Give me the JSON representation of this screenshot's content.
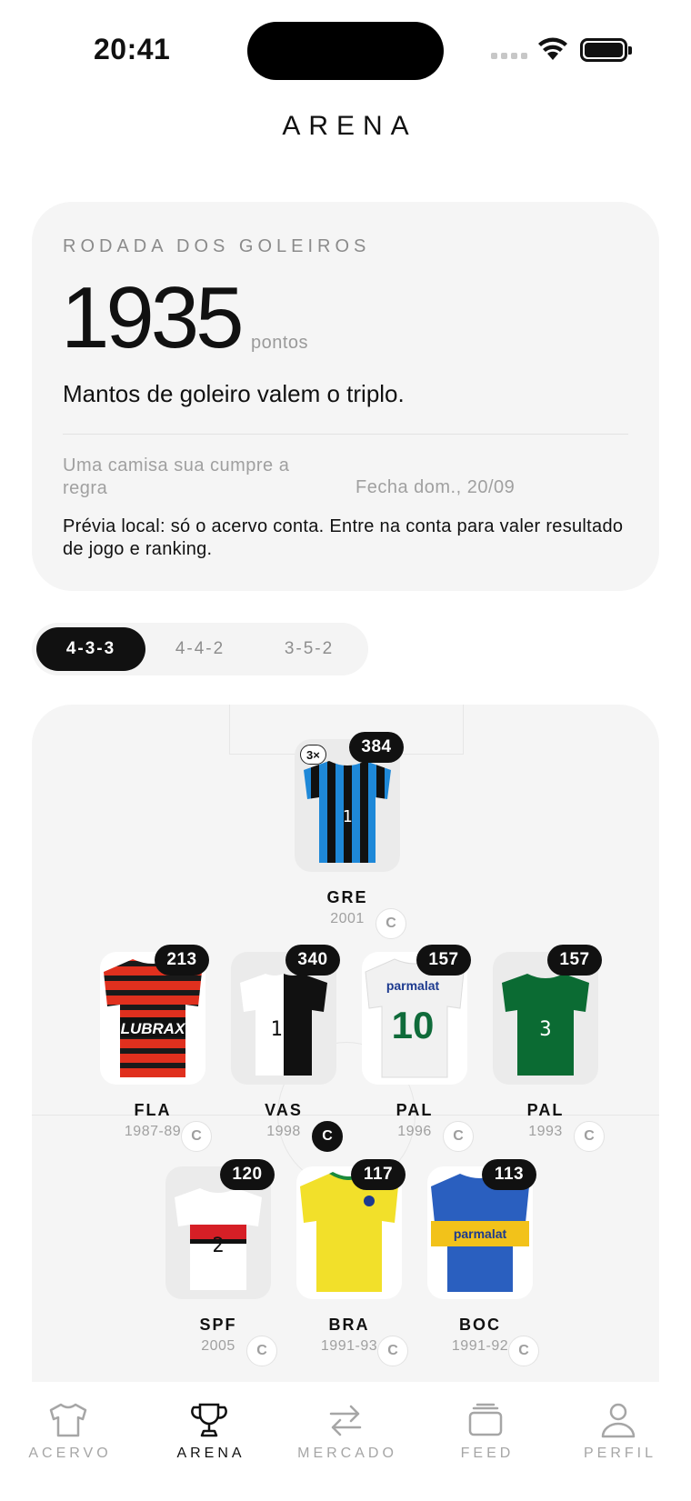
{
  "status_bar": {
    "time": "20:41"
  },
  "header": {
    "title": "ARENA"
  },
  "round": {
    "label": "RODADA DOS GOLEIROS",
    "points": "1935",
    "points_unit": "pontos",
    "rule": "Mantos de goleiro valem o triplo.",
    "status": "Uma camisa sua cumpre a regra",
    "deadline": "Fecha dom., 20/09",
    "note": "Prévia local: só o acervo conta. Entre na conta para valer resultado de jogo e ranking."
  },
  "formations": {
    "options": [
      "4-3-3",
      "4-4-2",
      "3-5-2"
    ],
    "selected": "4-3-3"
  },
  "lineup": {
    "captain_label": "C",
    "goalkeeper": {
      "club": "GRE",
      "year": "2001",
      "points": "384",
      "multiplier": "3×",
      "number": "1",
      "captain": false
    },
    "defenders": [
      {
        "club": "FLA",
        "year": "1987-89",
        "points": "213",
        "sponsor": "LUBRAX",
        "captain": false
      },
      {
        "club": "VAS",
        "year": "1998",
        "points": "340",
        "number": "1",
        "captain": true
      },
      {
        "club": "PAL",
        "year": "1996",
        "points": "157",
        "sponsor": "parmalat",
        "number": "10",
        "captain": false
      },
      {
        "club": "PAL",
        "year": "1993",
        "points": "157",
        "number": "3",
        "captain": false
      }
    ],
    "midfielders": [
      {
        "club": "SPF",
        "year": "2005",
        "points": "120",
        "number": "2",
        "captain": false
      },
      {
        "club": "BRA",
        "year": "1991-93",
        "points": "117",
        "captain": false
      },
      {
        "club": "BOC",
        "year": "1991-92",
        "points": "113",
        "sponsor": "parmalat",
        "captain": false
      }
    ]
  },
  "tabbar": {
    "items": [
      {
        "label": "ACERVO",
        "icon": "shirt-icon",
        "active": false
      },
      {
        "label": "ARENA",
        "icon": "trophy-icon",
        "active": true
      },
      {
        "label": "MERCADO",
        "icon": "swap-arrows-icon",
        "active": false
      },
      {
        "label": "FEED",
        "icon": "stack-icon",
        "active": false
      },
      {
        "label": "PERFIL",
        "icon": "person-icon",
        "active": false
      }
    ]
  },
  "colors": {
    "accent": "#111111",
    "card_bg": "#f5f5f5",
    "muted_text": "#a0a0a0",
    "background": "#ffffff"
  }
}
